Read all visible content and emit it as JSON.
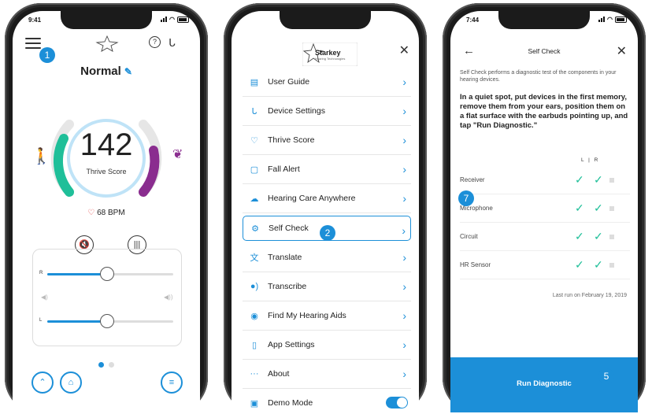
{
  "colors": {
    "accent": "#1c8fd8",
    "activity": "#1fbf99",
    "brain": "#8a2d8f",
    "heart": "#e23d3d"
  },
  "phone1": {
    "status_time": "9:41",
    "callout": "1",
    "memory_name": "Normal",
    "thrive_score": "142",
    "thrive_label": "Thrive Score",
    "heart_rate": "68 BPM",
    "slider_right_label": "R",
    "slider_left_label": "L",
    "slider_right_value": 0.47,
    "slider_left_value": 0.47,
    "icons": [
      "menu-icon",
      "star-logo-icon",
      "help-icon",
      "hearing-aid-icon",
      "walk-icon",
      "brain-icon",
      "mute-icon",
      "voice-icon",
      "expand-icon",
      "home-icon",
      "list-icon"
    ]
  },
  "phone2": {
    "logo_text": "Starkey",
    "logo_sub": "Hearing Technologies",
    "callout": "2",
    "items": [
      {
        "label": "User Guide",
        "icon": "book-icon"
      },
      {
        "label": "Device Settings",
        "icon": "hearing-aid-icon"
      },
      {
        "label": "Thrive Score",
        "icon": "heart-icon"
      },
      {
        "label": "Fall Alert",
        "icon": "alert-icon"
      },
      {
        "label": "Hearing Care Anywhere",
        "icon": "cloud-icon"
      },
      {
        "label": "Self Check",
        "icon": "self-check-icon"
      },
      {
        "label": "Translate",
        "icon": "translate-icon"
      },
      {
        "label": "Transcribe",
        "icon": "transcribe-icon"
      },
      {
        "label": "Find My Hearing Aids",
        "icon": "locate-icon"
      },
      {
        "label": "App Settings",
        "icon": "phone-icon"
      },
      {
        "label": "About",
        "icon": "more-icon"
      },
      {
        "label": "Demo Mode",
        "icon": "demo-icon"
      }
    ]
  },
  "phone3": {
    "status_time": "7:44",
    "title": "Self Check",
    "intro": "Self Check performs a diagnostic test of the components in your hearing devices.",
    "instruction": "In a quiet spot, put devices in the first memory, remove them from your ears, position them on a flat surface with the earbuds pointing up, and tap \"Run Diagnostic.\"",
    "col_header": "L | R",
    "rows": [
      "Receiver",
      "Microphone",
      "Circuit",
      "HR Sensor"
    ],
    "last_run": "Last run on February 19, 2019",
    "run_button": "Run Diagnostic",
    "callout_rows": "7",
    "callout_button": "5"
  }
}
